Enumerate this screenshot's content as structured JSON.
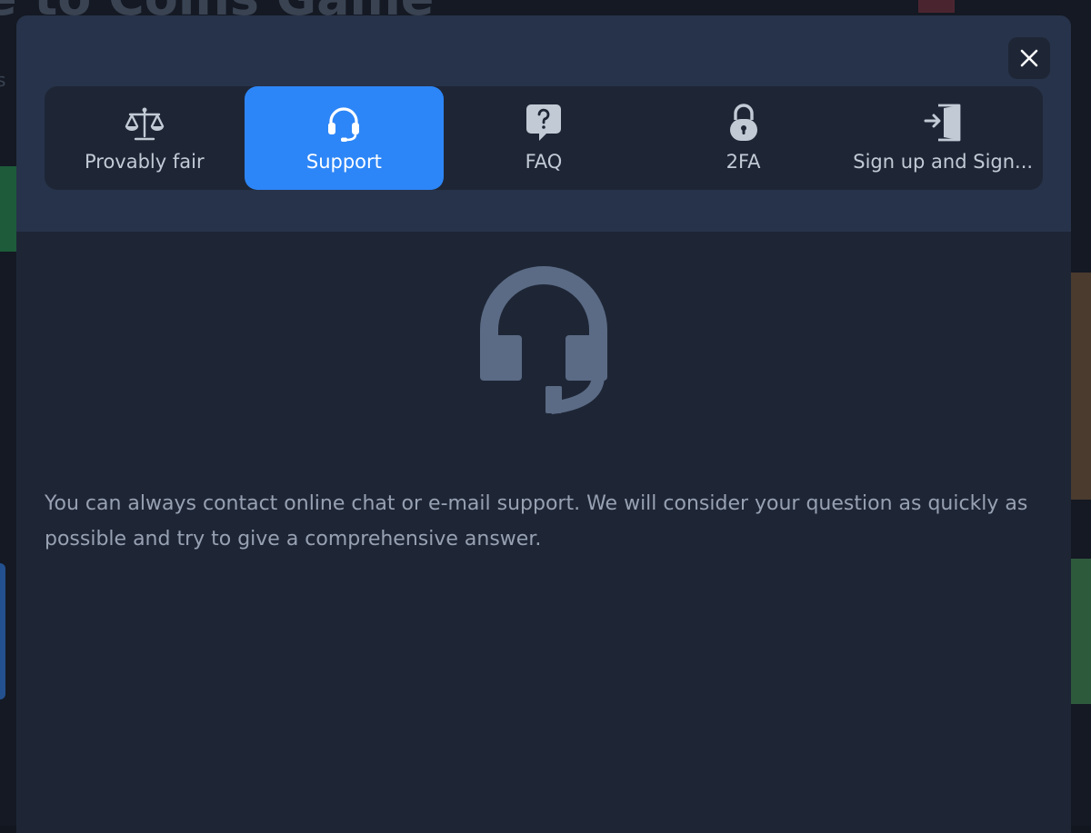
{
  "background": {
    "title": "e to Coins Game",
    "subtitle": "s"
  },
  "modal": {
    "close_icon": "close-icon",
    "tabs": [
      {
        "label": "Provably fair",
        "icon": "scales-icon",
        "active": false
      },
      {
        "label": "Support",
        "icon": "headset-icon",
        "active": true
      },
      {
        "label": "FAQ",
        "icon": "question-bubble-icon",
        "active": false
      },
      {
        "label": "2FA",
        "icon": "padlock-icon",
        "active": false
      },
      {
        "label": "Sign up and Sign...",
        "icon": "sign-in-door-icon",
        "active": false
      }
    ],
    "content": {
      "icon": "headset-icon",
      "description": "You can always contact online chat or e-mail support. We will consider your question as quickly as possible and try to give a comprehensive answer."
    }
  },
  "colors": {
    "accent": "#2d86f7",
    "modal_bg": "#1e2636",
    "header_bg": "#27334a",
    "icon_muted": "#5b6b85",
    "text_muted": "#97a1b1"
  }
}
